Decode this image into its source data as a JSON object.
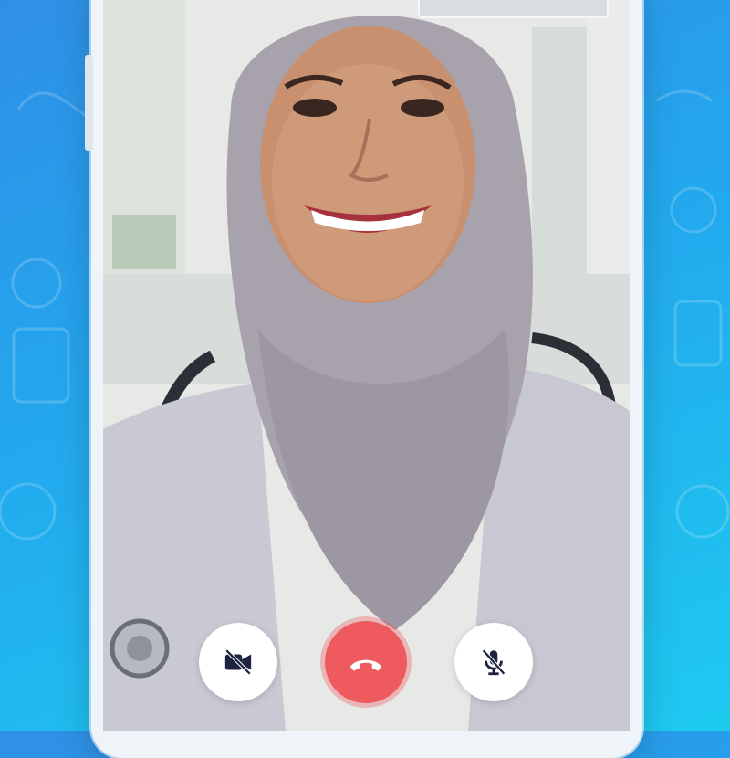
{
  "app": {
    "context": "video-call"
  },
  "call": {
    "remote_participant": "doctor-video-feed",
    "self_view": "self-preview-thumbnail"
  },
  "controls": [
    {
      "name": "camera-off-button",
      "icon": "video-off-icon",
      "state": "camera-off"
    },
    {
      "name": "end-call-button",
      "icon": "phone-hangup-icon",
      "state": "active"
    },
    {
      "name": "mute-button",
      "icon": "mic-off-icon",
      "state": "muted"
    }
  ],
  "colors": {
    "background_top": "#2f8fe6",
    "background_bottom": "#1ecaf0",
    "end_call": "#ef5a5e",
    "icon_dark": "#1d2440",
    "control_bg": "#ffffff"
  }
}
